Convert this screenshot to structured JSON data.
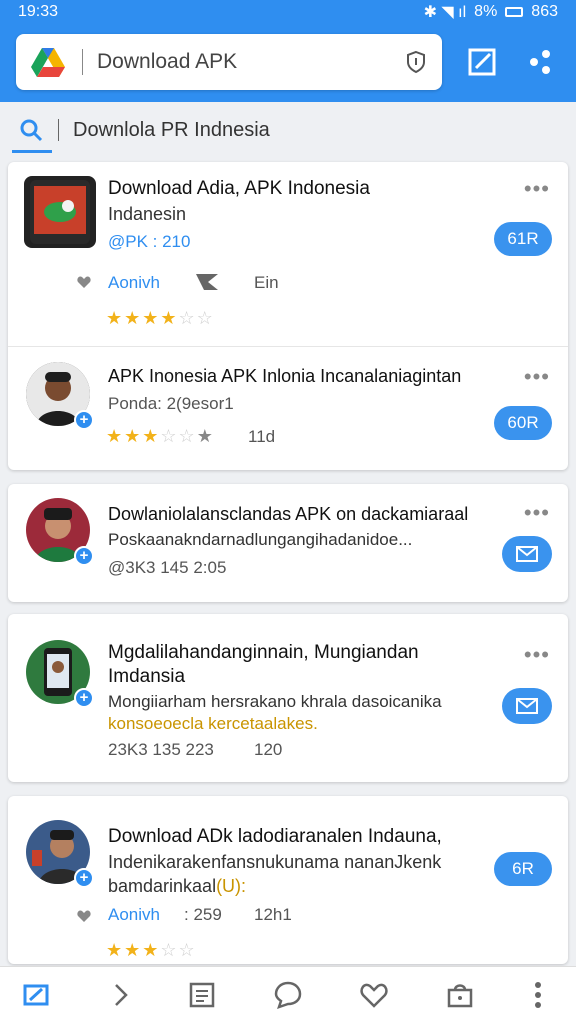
{
  "status_bar": {
    "time": "19:33",
    "battery": "8%",
    "extra": "863",
    "signal_glyphs": "✱ ◥ ıl"
  },
  "search": {
    "value": "Download APK"
  },
  "query": {
    "text": "Downlola PR Indnesia"
  },
  "cards": [
    {
      "title": "Download Adia, APK Indonesia",
      "subtitle": "Indanesin",
      "meta": "@PK : 210",
      "action_label": "Aonivh",
      "action2": "Ein",
      "button_label": "61R",
      "rating": 4
    },
    {
      "title": "APK Inonesia APK Inlonia Incanalaniagintan",
      "meta": "Ponda: 2(9esor1",
      "rating_value": "11d",
      "button_label": "60R",
      "rating": 3
    },
    {
      "title": "Dowlaniolalansclandas APK on dackamiaraal",
      "subtitle": "Poskaanakndarnadlungangihadanidoe...",
      "meta": "@3K3 145 2:05"
    },
    {
      "title": "Mgdalilahandanginnain, Mungiandan",
      "title2": "Imdansia",
      "subtitle": "Mongiiarham hersrakano khrala dasoicanika",
      "subtitle2": "konsoeoecla kercetaalakes.",
      "meta": "23K3 135 223",
      "meta2": "120"
    },
    {
      "title": "Download ADk ladodiaranalen Indauna,",
      "subtitle": "Indenikarakenfansnukunama nananJkenk",
      "subtitle2_plain": "bamdarinkaal",
      "subtitle2_gold": "(U):",
      "action_label": "Aonivh",
      "meta": ": 259",
      "meta2": "12h1",
      "button_label": "6R",
      "rating": 3
    }
  ],
  "icons": {
    "logo": "google-drive-logo",
    "shield": "shield-icon",
    "edit": "edit-icon",
    "share": "share-icon",
    "search": "search-icon",
    "more": "more-icon",
    "heart": "heart-icon",
    "mail": "mail-icon"
  },
  "colors": {
    "accent": "#2f8ef0",
    "star": "#f2b21a"
  }
}
